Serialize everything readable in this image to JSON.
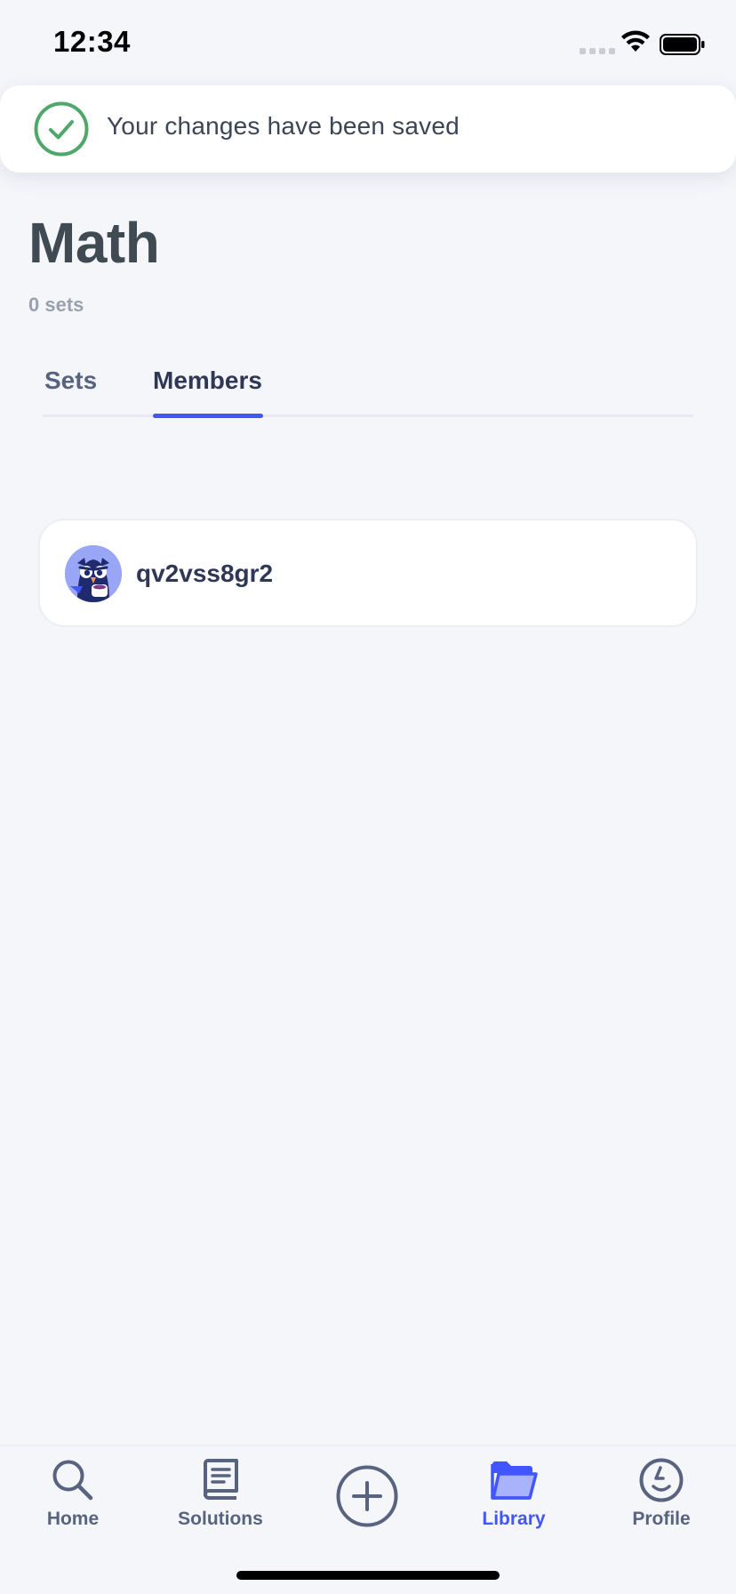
{
  "status_bar": {
    "time": "12:34"
  },
  "toast": {
    "message": "Your changes have been saved",
    "icon": "check-circle-icon",
    "accent_color": "#4fa86a"
  },
  "header": {
    "title": "Math",
    "subtitle": "0 sets"
  },
  "tabs": [
    {
      "label": "Sets",
      "selected": false
    },
    {
      "label": "Members",
      "selected": true
    }
  ],
  "members": [
    {
      "username": "qv2vss8gr2",
      "avatar": "owl-avatar"
    }
  ],
  "bottom_nav": {
    "items": [
      {
        "label": "Home",
        "icon": "search-icon",
        "active": false
      },
      {
        "label": "Solutions",
        "icon": "book-icon",
        "active": false
      },
      {
        "label": "",
        "icon": "plus-circle-icon",
        "active": false
      },
      {
        "label": "Library",
        "icon": "folder-icon",
        "active": true
      },
      {
        "label": "Profile",
        "icon": "profile-icon",
        "active": false
      }
    ]
  },
  "colors": {
    "primary": "#4255ff",
    "background": "#f5f6fa",
    "text": "#2e3856",
    "muted": "#586380"
  }
}
